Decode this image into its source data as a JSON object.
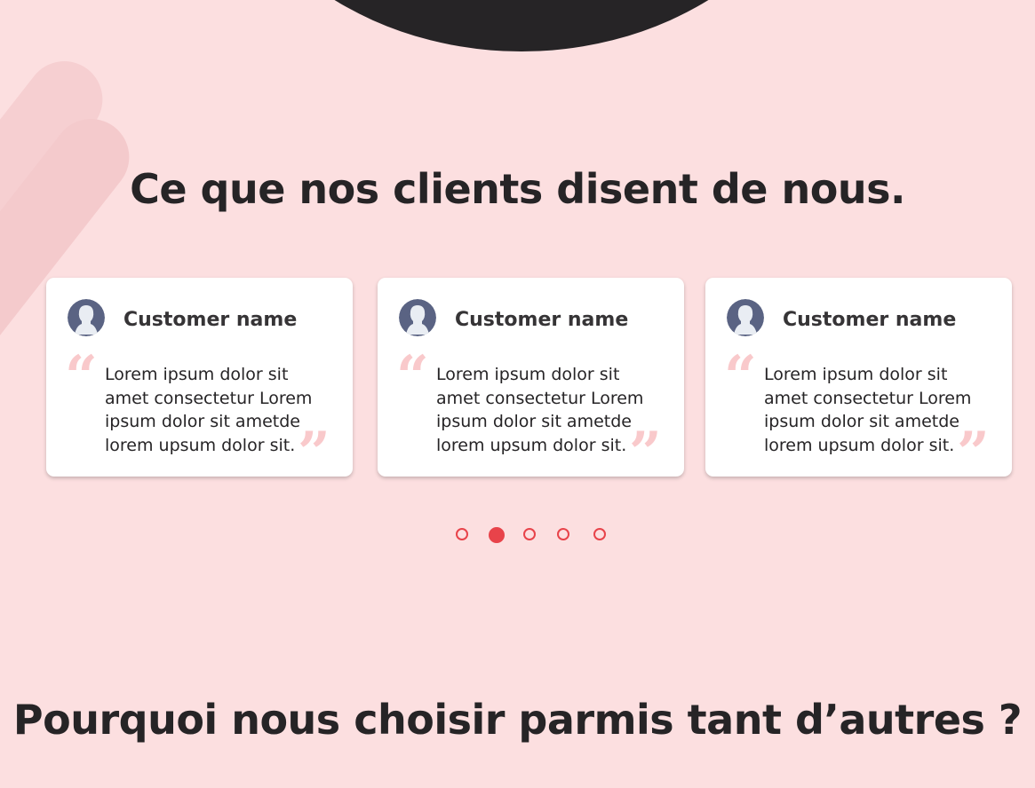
{
  "testimonials": {
    "title": "Ce que nos clients disent de nous.",
    "cards": [
      {
        "name": "Customer name",
        "text": "Lorem ipsum dolor sit amet consectetur Lorem ipsum dolor sit ametde lorem upsum dolor sit.",
        "quote_open": "“",
        "quote_close": "”"
      },
      {
        "name": "Customer name",
        "text": "Lorem ipsum dolor sit amet consectetur Lorem ipsum dolor sit ametde lorem upsum dolor sit.",
        "quote_open": "“",
        "quote_close": "”"
      },
      {
        "name": "Customer name",
        "text": "Lorem ipsum dolor sit amet consectetur Lorem ipsum dolor sit ametde lorem upsum dolor sit.",
        "quote_open": "“",
        "quote_close": "”"
      }
    ],
    "carousel": {
      "pages": 5,
      "active_page": 2
    }
  },
  "why_us": {
    "title": "Pourquoi nous choisir parmis tant d’autres ?"
  },
  "icons": {
    "avatar": "user-silhouette-icon"
  },
  "colors": {
    "background": "#fcdfe0",
    "accent": "#e8434a",
    "dark": "#262426",
    "quote": "#f9c9cb",
    "avatar_bg": "#5a6383"
  }
}
